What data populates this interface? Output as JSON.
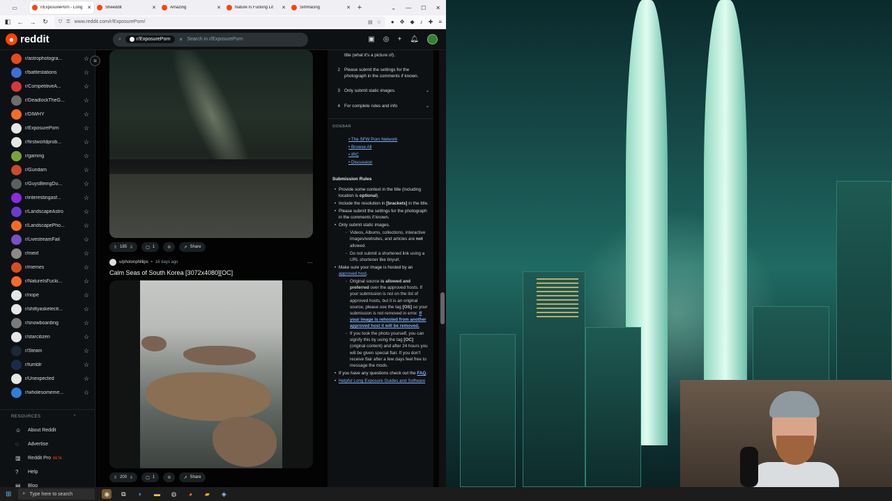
{
  "browser": {
    "tabs": [
      {
        "title": "r/ExposurePorn - Long",
        "active": true
      },
      {
        "title": "Sheeddit",
        "active": false
      },
      {
        "title": "Amazing",
        "active": false
      },
      {
        "title": "Nature Is Fucking Lit",
        "active": false
      },
      {
        "title": "SimRacing",
        "active": false
      }
    ],
    "url": "www.reddit.com/r/ExposurePorn/"
  },
  "header": {
    "logo": "reddit",
    "chip": "r/ExposurePorn",
    "search_placeholder": "Search in r/ExposurePorn"
  },
  "sidebar": {
    "communities": [
      {
        "name": "r/astrophotogra...",
        "color": "#e8491d"
      },
      {
        "name": "r/battlestations",
        "color": "#3b6fd9"
      },
      {
        "name": "r/CompetitiveA...",
        "color": "#d9363e"
      },
      {
        "name": "r/DeadlockTheG...",
        "color": "#6d6d6d"
      },
      {
        "name": "r/DIWHY",
        "color": "#ff6a21"
      },
      {
        "name": "r/ExposurePorn",
        "color": "#e6e6e6"
      },
      {
        "name": "r/firstworldprob...",
        "color": "#e6e6e6"
      },
      {
        "name": "r/gaming",
        "color": "#7aa23a"
      },
      {
        "name": "r/Gundam",
        "color": "#c94a2c"
      },
      {
        "name": "r/GuysBeingDu...",
        "color": "#5e5e5e"
      },
      {
        "name": "r/interestingasf...",
        "color": "#8a2be2"
      },
      {
        "name": "r/LandscapeAstro",
        "color": "#6a3bd1"
      },
      {
        "name": "r/LandscapePho...",
        "color": "#ff6a21"
      },
      {
        "name": "r/LivestreamFail",
        "color": "#7b4fc6"
      },
      {
        "name": "r/meirl",
        "color": "#8a8a8a"
      },
      {
        "name": "r/memes",
        "color": "#d94e1d"
      },
      {
        "name": "r/NatureIsFucki...",
        "color": "#ff6a21"
      },
      {
        "name": "r/nope",
        "color": "#e6e6e6"
      },
      {
        "name": "r/shittyaskelectr...",
        "color": "#e6e6e6"
      },
      {
        "name": "r/snowboarding",
        "color": "#7a7a7a"
      },
      {
        "name": "r/starcitizen",
        "color": "#e6e6e6"
      },
      {
        "name": "r/Steam",
        "color": "#1b2838"
      },
      {
        "name": "r/tumblr",
        "color": "#1c2a4a"
      },
      {
        "name": "r/Unexpected",
        "color": "#e6e6e6"
      },
      {
        "name": "r/wholesomeme...",
        "color": "#2d7fd9"
      }
    ],
    "resources_label": "RESOURCES",
    "resources": [
      {
        "label": "About Reddit",
        "icon": "☺"
      },
      {
        "label": "Advertise",
        "icon": "◌"
      },
      {
        "label": "Reddit Pro",
        "icon": "▥",
        "badge": "BETA"
      },
      {
        "label": "Help",
        "icon": "?"
      },
      {
        "label": "Blog",
        "icon": "▤"
      }
    ]
  },
  "feed": {
    "post1": {
      "votes": "185",
      "comments": "1",
      "share": "Share"
    },
    "post2": {
      "user": "u/photonphillips",
      "age": "16 days ago",
      "title": "Calm Seas of South Korea [3072x4080][OC]",
      "votes": "200",
      "comments": "1",
      "share": "Share"
    }
  },
  "rules": {
    "items": [
      {
        "num": "",
        "text": "title (what it's a picture of).",
        "chevron": false
      },
      {
        "num": "2",
        "text": "Please submit the settings for the photograph in the comments if known.",
        "chevron": false
      },
      {
        "num": "3",
        "text": "Only submit static images.",
        "chevron": true
      },
      {
        "num": "4",
        "text": "For complete rules and info",
        "chevron": true
      }
    ],
    "sidebar_label": "SIDEBAR",
    "links": [
      "The SFW Porn Network",
      "Browse All",
      "IRC",
      "Discussion"
    ],
    "submission_title": "Submission Rules",
    "b1a": "Provide some context in the title (including location is ",
    "b1b": "optional",
    "b1c": ").",
    "b2a": "Include the resolution in ",
    "b2b": "[brackets]",
    "b2c": " in the title.",
    "b3": "Please submit the settings for the photograph in the comments if known.",
    "b4": "Only submit static images.",
    "s1a": "Videos, Albums, collections, interactive images/websites, and articles are ",
    "s1b": "not",
    "s1c": " allowed.",
    "s2": "Do not submit a shortened link using a URL shortener like tinyurl.",
    "b5a": "Make sure your image is hosted by an ",
    "b5link": "approved host",
    "b5c": ".",
    "s3a": "Original source ",
    "s3b": "is allowed and preferred",
    "s3c": " over the approved hosts. If your submission is not on the list of approved hosts, but it is an original source, please use the tag ",
    "s3d": "[OS]",
    "s3e": " so your submission is not removed in error. ",
    "s3link": "If your image is rehosted from another approved host it will be removed.",
    "s4a": "If you took the photo yourself, you can signify this by using the tag ",
    "s4b": "[OC]",
    "s4c": " (original content) and after 24 hours you will be given special flair. If you don't receive flair after a few days feel free to message the mods.",
    "b6a": "If you have any questions check out the ",
    "b6link": "FAQ",
    "b6c": ".",
    "b7link": "Helpful Long Exposure Guides and Software"
  },
  "taskbar": {
    "search_placeholder": "Type here to search"
  }
}
